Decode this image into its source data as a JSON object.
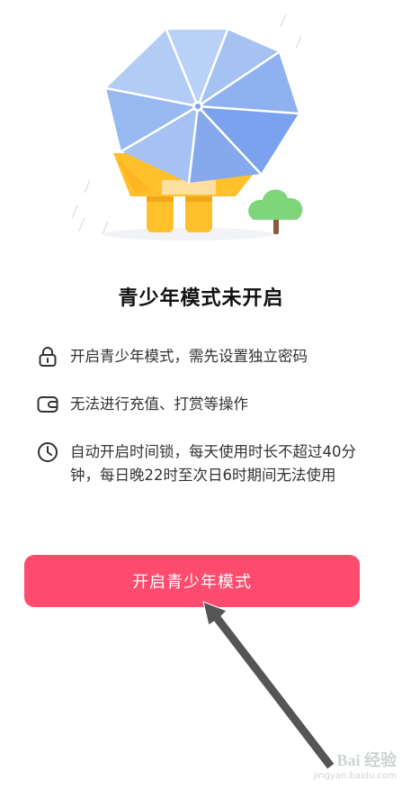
{
  "title": "青少年模式未开启",
  "items": [
    {
      "icon": "lock-icon",
      "text": "开启青少年模式，需先设置独立密码"
    },
    {
      "icon": "wallet-icon",
      "text": "无法进行充值、打赏等操作"
    },
    {
      "icon": "clock-icon",
      "text": "自动开启时间锁，每天使用时长不超过40分钟，每日晚22时至次日6时期间无法使用"
    }
  ],
  "button_label": "开启青少年模式",
  "watermark": {
    "brand": "Bai 经验",
    "url": "jingyan.baidu.com"
  },
  "colors": {
    "accent": "#fe4b6e",
    "umbrella_light": "#a9c6f5",
    "umbrella_dark": "#7aa2ee",
    "raincoat": "#ffc02b",
    "tree": "#7fd57a"
  }
}
